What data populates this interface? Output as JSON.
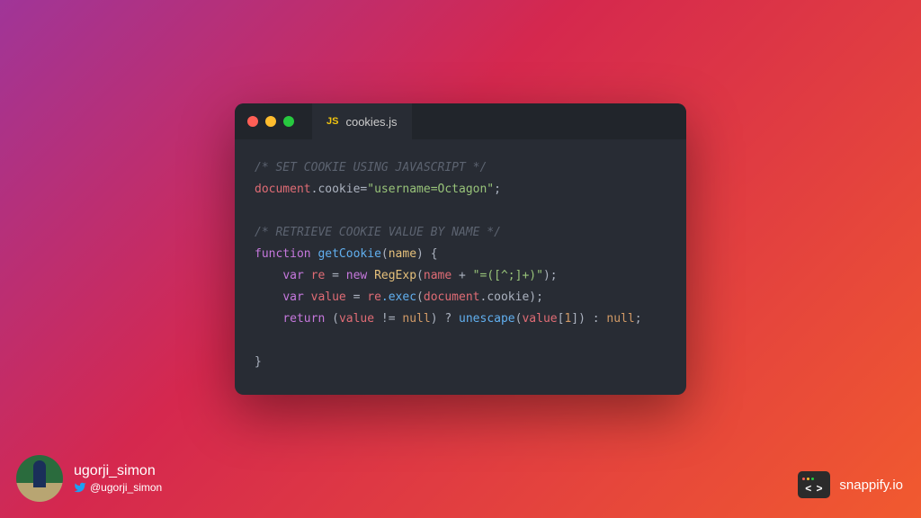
{
  "editor": {
    "tab": {
      "lang_badge": "JS",
      "filename": "cookies.js"
    },
    "code": {
      "l1_comment": "/* SET COOKIE USING JAVASCRIPT */",
      "l2_document": "document",
      "l2_cookie": ".cookie",
      "l2_eq": "=",
      "l2_str": "\"username=Octagon\"",
      "l2_semi": ";",
      "l4_comment": "/* RETRIEVE COOKIE VALUE BY NAME */",
      "l5_function": "function",
      "l5_fname": " getCookie",
      "l5_open": "(",
      "l5_param": "name",
      "l5_close": ") {",
      "l6_indent": "    ",
      "l6_var": "var",
      "l6_re": " re ",
      "l6_eq": "= ",
      "l6_new": "new",
      "l6_regexp": " RegExp",
      "l6_open": "(",
      "l6_name": "name",
      "l6_plus": " + ",
      "l6_str": "\"=([^;]+)\"",
      "l6_close": ");",
      "l7_indent": "    ",
      "l7_var": "var",
      "l7_value": " value ",
      "l7_eq": "= ",
      "l7_re": "re",
      "l7_exec": ".exec",
      "l7_open": "(",
      "l7_document": "document",
      "l7_cookie": ".cookie",
      "l7_close": ");",
      "l8_indent": "    ",
      "l8_return": "return",
      "l8_open": " (",
      "l8_value": "value",
      "l8_neq": " != ",
      "l8_null1": "null",
      "l8_close1": ") ? ",
      "l8_unescape": "unescape",
      "l8_open2": "(",
      "l8_value2": "value",
      "l8_bracket": "[",
      "l8_num": "1",
      "l8_bracket2": "]) : ",
      "l8_null2": "null",
      "l8_semi": ";",
      "l10_brace": "}"
    }
  },
  "user": {
    "name": "ugorji_simon",
    "handle": "@ugorji_simon"
  },
  "brand": {
    "name": "snappify.io",
    "arrows": "< >"
  }
}
